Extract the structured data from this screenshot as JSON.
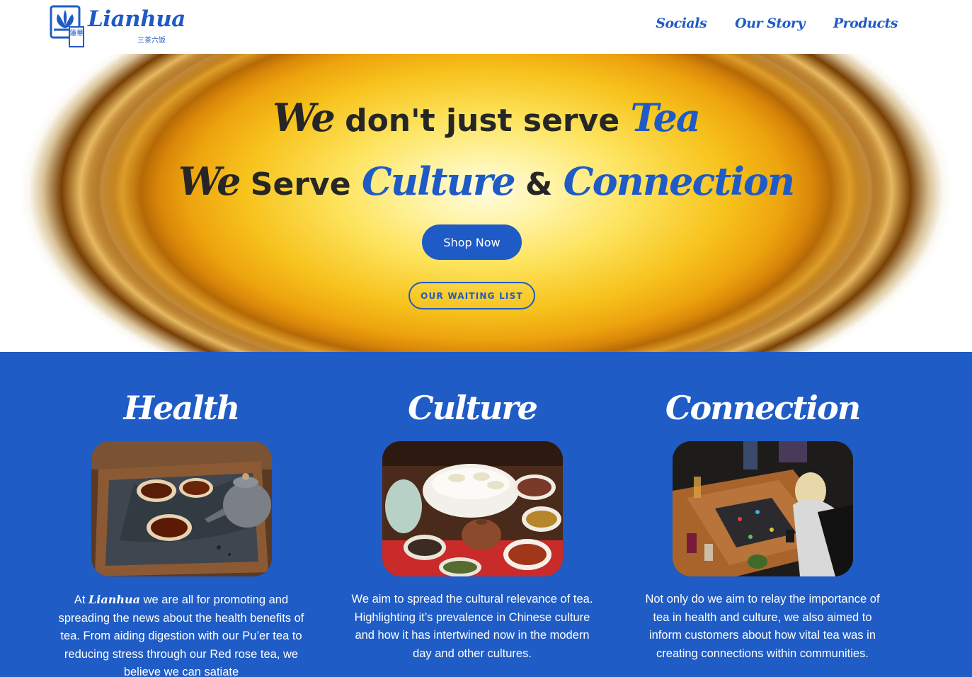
{
  "brand": {
    "name": "Lianhua",
    "subtitle": "三茶六饭",
    "emblem_text": "蓮華",
    "colors": {
      "primary": "#1f5bc6",
      "hero_gold": "#f7c21c",
      "dark_text": "#262626"
    }
  },
  "nav": {
    "items": [
      {
        "label": "Socials"
      },
      {
        "label": "Our Story"
      },
      {
        "label": "Products"
      }
    ]
  },
  "hero": {
    "line1": {
      "we": "We",
      "middle": " don't just serve ",
      "tea": "Tea"
    },
    "line2": {
      "we": "We",
      "serve": " Serve ",
      "culture": "Culture",
      "amp": " & ",
      "connection": "Connection"
    },
    "shop_button": "Shop Now",
    "waiting_button": "OUR WAITING LIST",
    "background": "golden tea cup seen from above"
  },
  "features": [
    {
      "title": "Health",
      "image_icon": "teapot-and-cups-icon",
      "text_prefix": "At ",
      "text_brand": "Lianhua",
      "text": " we are all for promoting and spreading the news about the health benefits of tea. From aiding digestion with our Pu’er tea to reducing stress through our Red rose tea, we believe we can satiate"
    },
    {
      "title": "Culture",
      "image_icon": "tea-ceremony-icon",
      "text": "We aim to spread the cultural relevance of tea. Highlighting it’s prevalence in Chinese culture and how it has intertwined now in the modern day and other cultures."
    },
    {
      "title": "Connection",
      "image_icon": "board-game-table-icon",
      "text": "Not only do we aim to relay the importance of tea in health and culture, we also aimed to inform customers about how vital tea was in creating connections within communities."
    }
  ]
}
